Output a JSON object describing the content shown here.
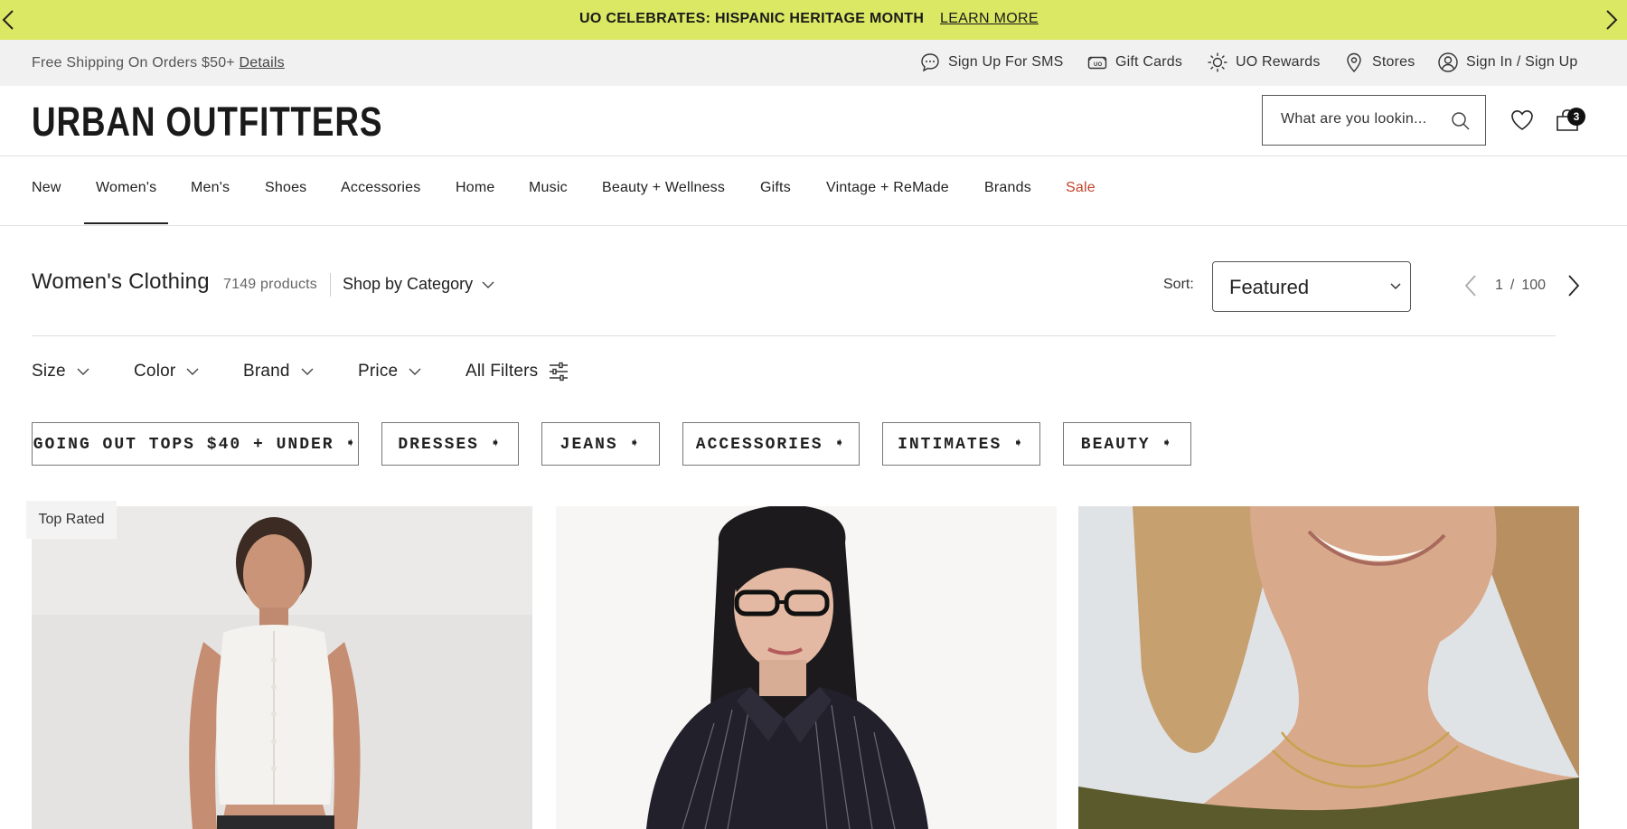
{
  "promo": {
    "text": "UO CELEBRATES: HISPANIC HERITAGE MONTH",
    "link": "LEARN MORE"
  },
  "utility": {
    "shipping_text": "Free Shipping On Orders $50+",
    "details_link": "Details",
    "items": [
      "Sign Up For SMS",
      "Gift Cards",
      "UO Rewards",
      "Stores",
      "Sign In / Sign Up"
    ]
  },
  "header": {
    "logo": "URBAN OUTFITTERS",
    "search_placeholder": "What are you lookin...",
    "cart_count": "3"
  },
  "nav": [
    "New",
    "Women's",
    "Men's",
    "Shoes",
    "Accessories",
    "Home",
    "Music",
    "Beauty + Wellness",
    "Gifts",
    "Vintage + ReMade",
    "Brands",
    "Sale"
  ],
  "nav_active": "Women's",
  "sale_color": "#c6432b",
  "page": {
    "title": "Women's Clothing",
    "count": "7149 products",
    "shop_by": "Shop by Category",
    "sort_label": "Sort:",
    "sort_value": "Featured",
    "page_current": "1",
    "page_sep": "/",
    "page_total": "100"
  },
  "filters": [
    "Size",
    "Color",
    "Brand",
    "Price",
    "All Filters"
  ],
  "chips": [
    "GOING OUT TOPS $40 + UNDER ➧",
    "DRESSES ➧",
    "JEANS ➧",
    "ACCESSORIES ➧",
    "INTIMATES ➧",
    "BEAUTY ➧"
  ],
  "products": [
    {
      "badge": "Top Rated"
    },
    {},
    {}
  ],
  "colors": {
    "promo_bg": "#dbe863",
    "util_bg": "#f1f1f1"
  }
}
